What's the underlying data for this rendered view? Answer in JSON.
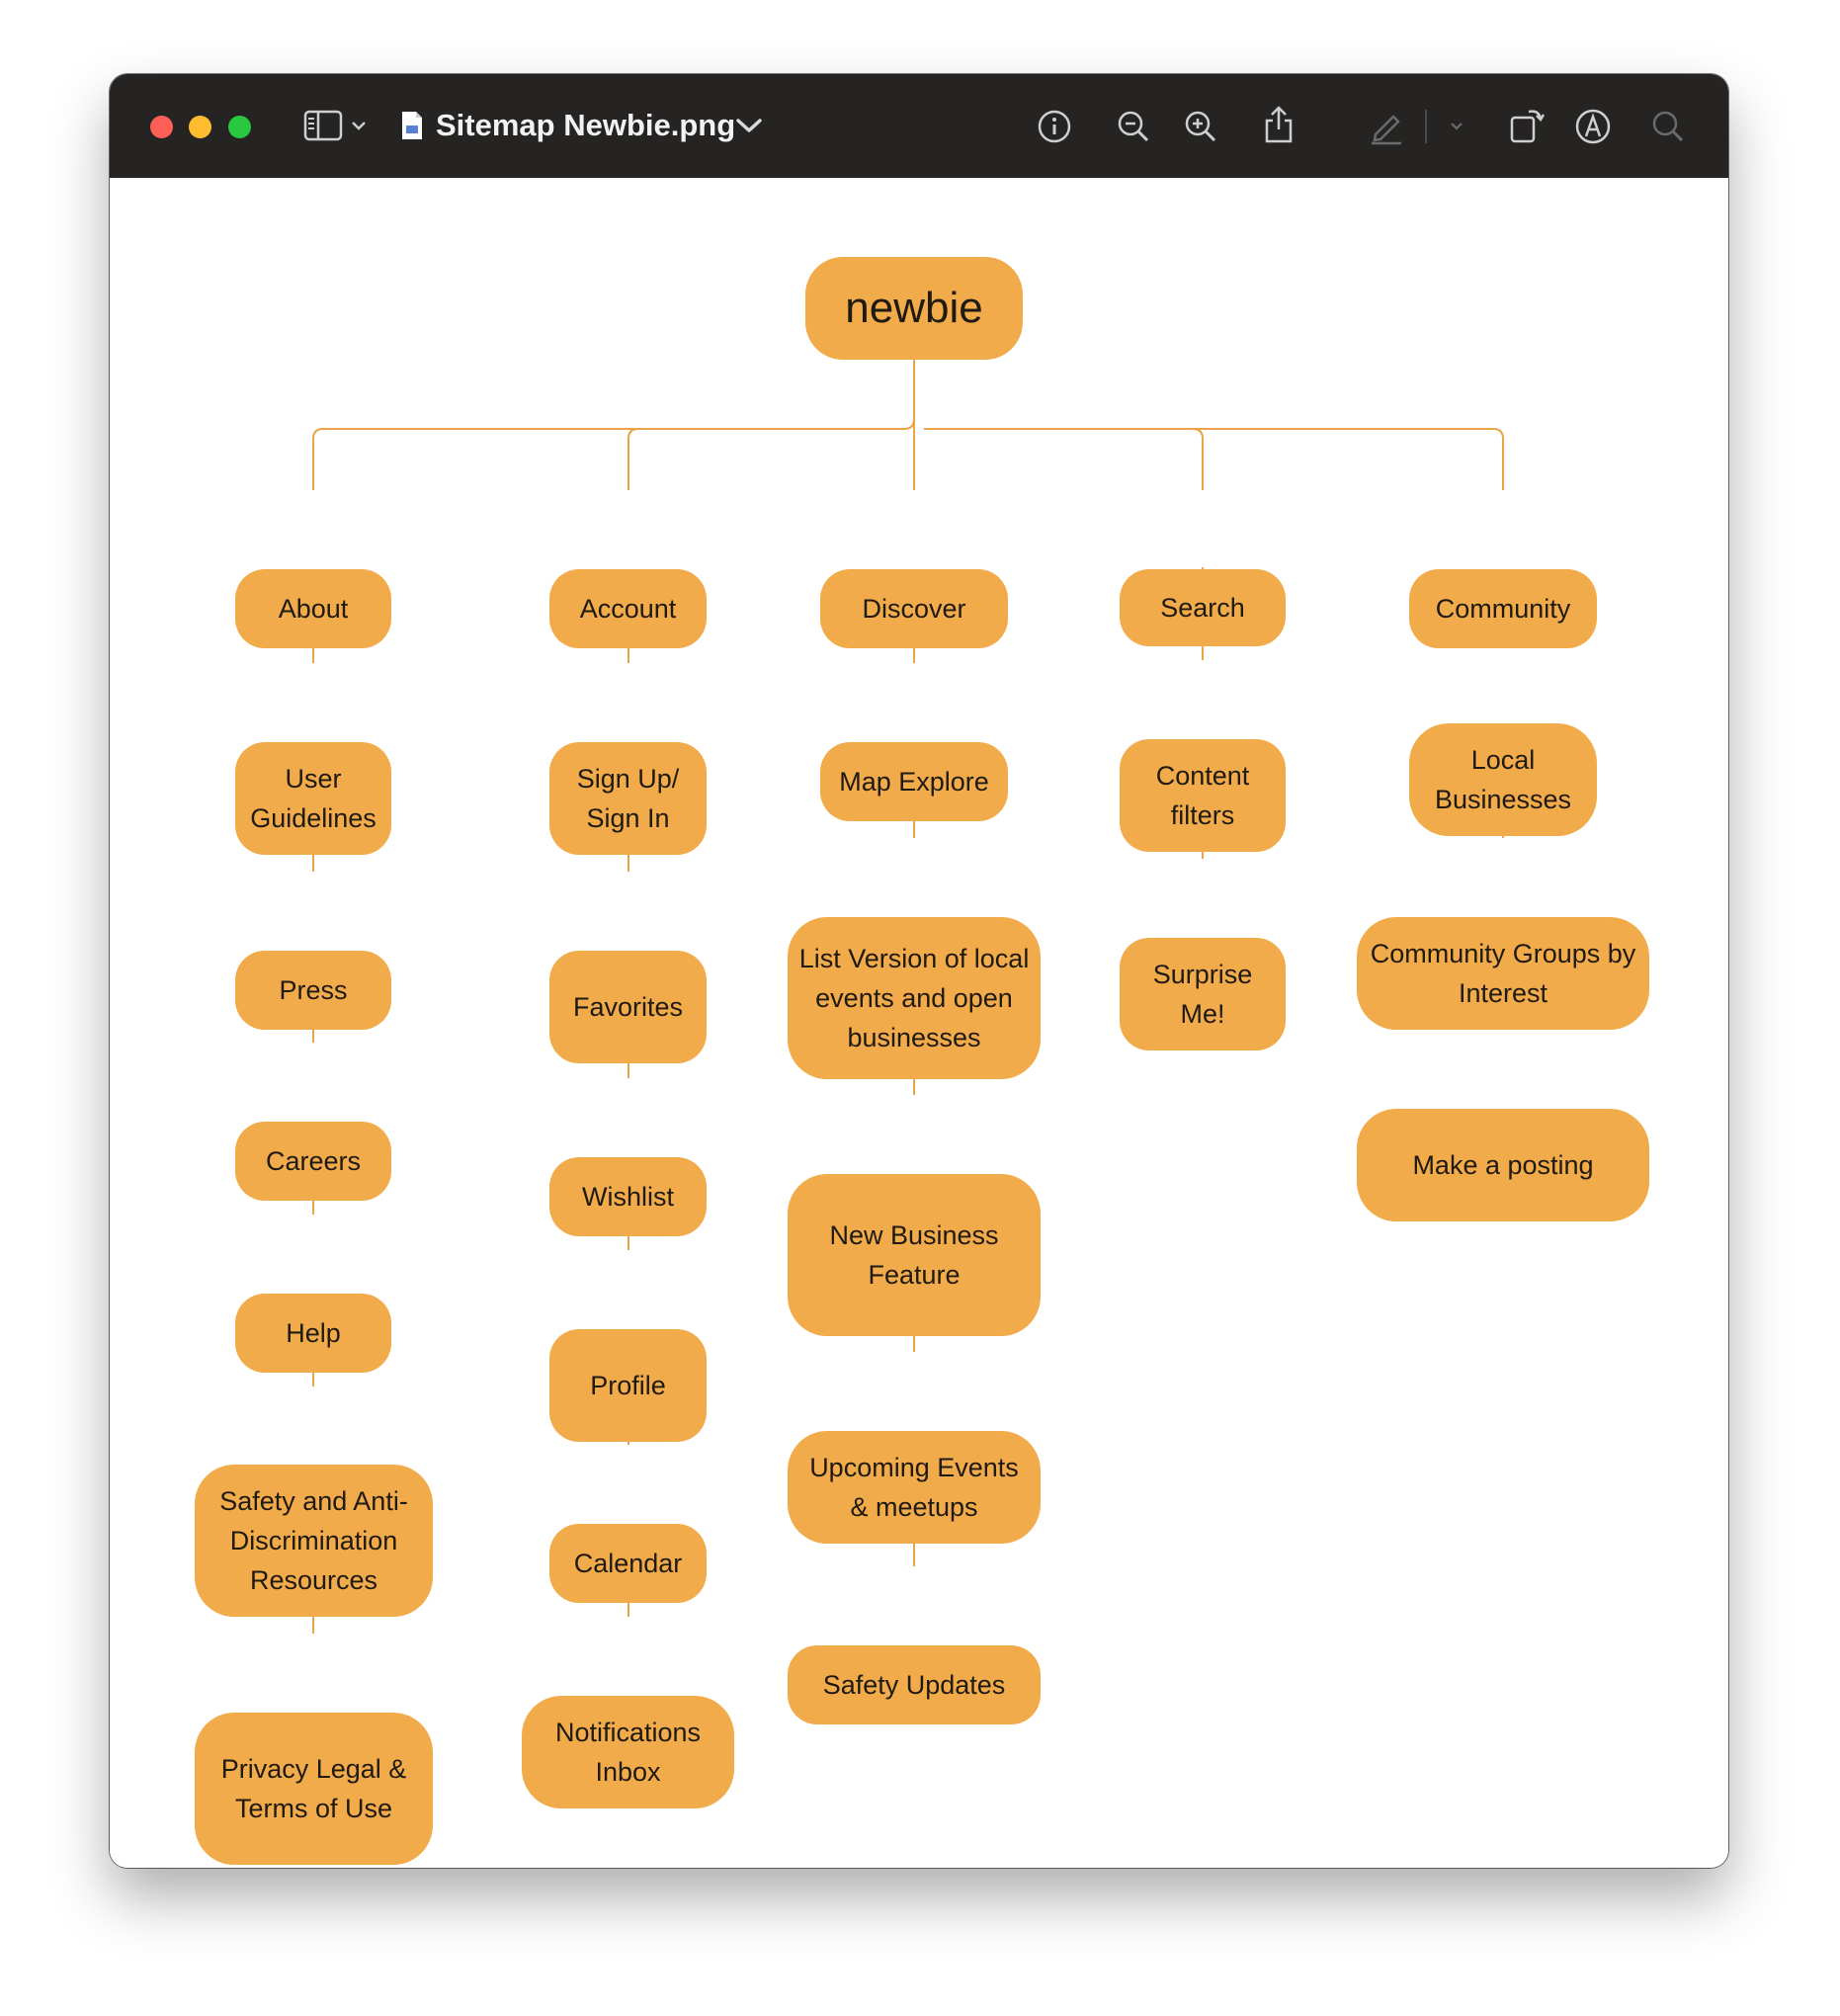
{
  "window": {
    "title": "Sitemap Newbie.png"
  },
  "toolbar": {
    "icons": [
      "sidebar-icon",
      "chevron-down-icon",
      "document-icon",
      "info-icon",
      "zoom-out-icon",
      "zoom-in-icon",
      "share-icon",
      "markup-pen-icon",
      "rotate-icon",
      "annotate-icon",
      "search-icon"
    ]
  },
  "colors": {
    "node_fill": "#f2ab4a",
    "connector": "#eaa448",
    "titlebar": "#252422"
  },
  "sitemap": {
    "root": "newbie",
    "about": {
      "label": "About",
      "children": [
        "User Guidelines",
        "Press",
        "Careers",
        "Help",
        "Safety and Anti-Discrimination Resources",
        "Privacy Legal & Terms of Use"
      ]
    },
    "account": {
      "label": "Account",
      "children": [
        "Sign Up/ Sign In",
        "Favorites",
        "Wishlist",
        "Profile",
        "Calendar",
        "Notifications Inbox"
      ]
    },
    "discover": {
      "label": "Discover",
      "children": [
        "Map Explore",
        "List Version of local events and open businesses",
        "New Business Feature",
        "Upcoming Events & meetups",
        "Safety Updates"
      ]
    },
    "search": {
      "label": "Search",
      "children": [
        "Content filters",
        "Surprise Me!"
      ]
    },
    "community": {
      "label": "Community",
      "children": [
        "Local Businesses",
        "Community Groups by Interest",
        "Make a posting"
      ]
    }
  }
}
